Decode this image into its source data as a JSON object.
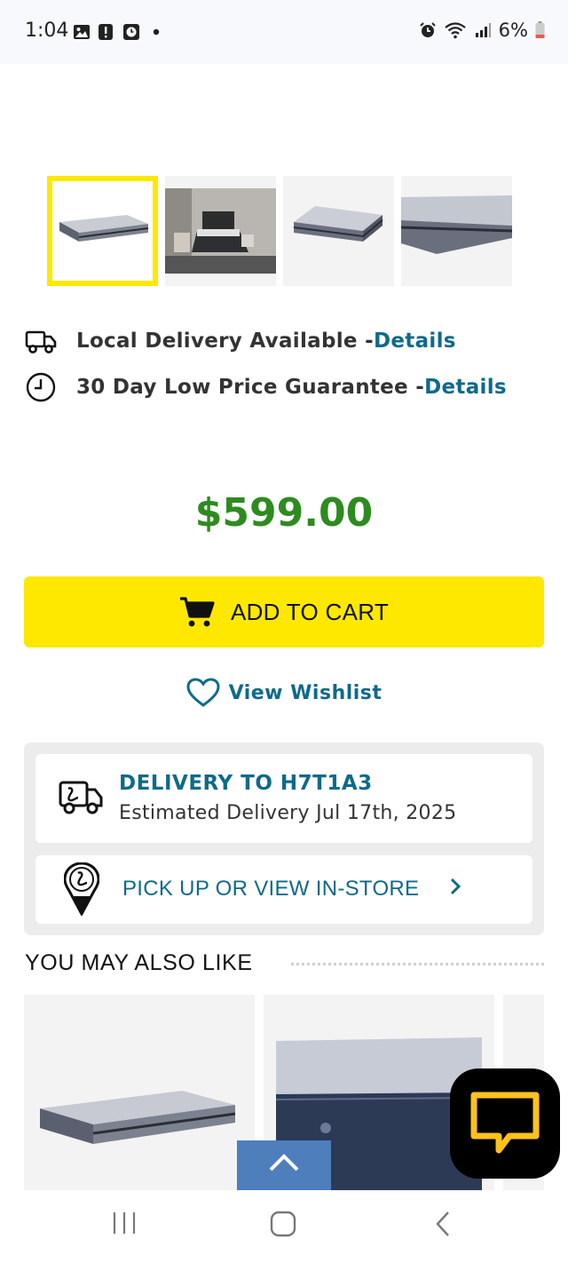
{
  "status_bar": {
    "time": "1:04",
    "battery": "6%",
    "icons": [
      "image-icon",
      "alert-icon",
      "clock-app-icon",
      "dot-icon",
      "alarm-icon",
      "wifi-icon",
      "signal-icon",
      "battery-icon"
    ]
  },
  "gallery": {
    "thumbnails": [
      "mattress-front",
      "bedroom-scene",
      "mattress-angle",
      "mattress-closeup"
    ],
    "selected_index": 0
  },
  "info": {
    "delivery_text": "Local Delivery Available - ",
    "delivery_link": "Details",
    "guarantee_text": "30 Day Low Price Guarantee - ",
    "guarantee_link": "Details"
  },
  "price": "$599.00",
  "add_to_cart_label": "ADD TO CART",
  "wishlist_label": "View Wishlist",
  "delivery": {
    "title": "DELIVERY TO H7T1A3",
    "estimate": "Estimated Delivery Jul 17th, 2025",
    "pickup_label": "PICK UP OR VIEW IN-STORE"
  },
  "recommendations": {
    "heading": "YOU MAY ALSO LIKE",
    "items": [
      "plaid-mattress",
      "blue-mattress",
      "partial-item"
    ]
  },
  "colors": {
    "accent_yellow": "#ffe800",
    "link_blue": "#0e6a8a",
    "price_green": "#2e8b1f",
    "scroll_blue": "#4f7ebd"
  }
}
